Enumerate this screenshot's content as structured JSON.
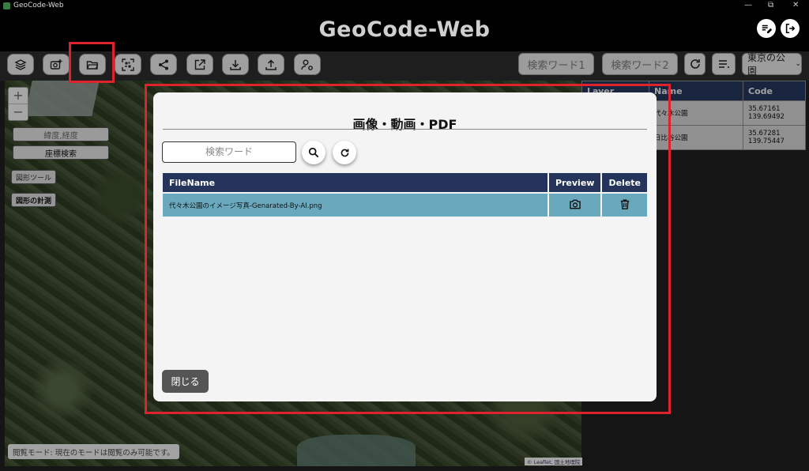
{
  "window": {
    "title": "GeoCode-Web",
    "controls": [
      "—",
      "⧉",
      "✕"
    ]
  },
  "header": {
    "brand": "GeoCode-Web",
    "edit_icon": "edit-list-icon",
    "logout_icon": "logout-icon"
  },
  "toolbar": {
    "buttons": [
      "layers-icon",
      "add-photo-icon",
      "folder-open-icon",
      "qr-code-icon",
      "share-icon",
      "external-link-icon",
      "download-icon",
      "upload-icon",
      "user-settings-icon"
    ],
    "keyword1": "検索ワード1",
    "keyword2": "検索ワード2",
    "select_value": "東京の公園"
  },
  "map": {
    "zoom_in": "+",
    "zoom_out": "−",
    "latlng_button": "緯度,経度",
    "coord_search_button": "座標検索",
    "shape_tools": "図形ツール",
    "shape_measure": "図形の計測",
    "status": "閲覧モード: 現在のモードは閲覧のみ可能です。",
    "attribution": "© Leaflet, 国土地理院"
  },
  "result_table": {
    "headers": [
      "Layer",
      "Name",
      "Code"
    ],
    "rows": [
      {
        "name": "代々木公園",
        "lat": "35.67161",
        "lng": "139.69492"
      },
      {
        "name": "日比谷公園",
        "lat": "35.67281",
        "lng": "139.75447"
      }
    ]
  },
  "modal": {
    "title": "画像・動画・PDF",
    "search_placeholder": "検索ワード",
    "file_table": {
      "headers": [
        "FileName",
        "Preview",
        "Delete"
      ],
      "rows": [
        {
          "filename": "代々木公園のイメージ写真-Genarated-By-AI.png"
        }
      ]
    },
    "close_label": "閉じる"
  },
  "colors": {
    "highlight": "#e0222c",
    "table_header": "#24345a",
    "row_selected": "#6aa9bd"
  }
}
